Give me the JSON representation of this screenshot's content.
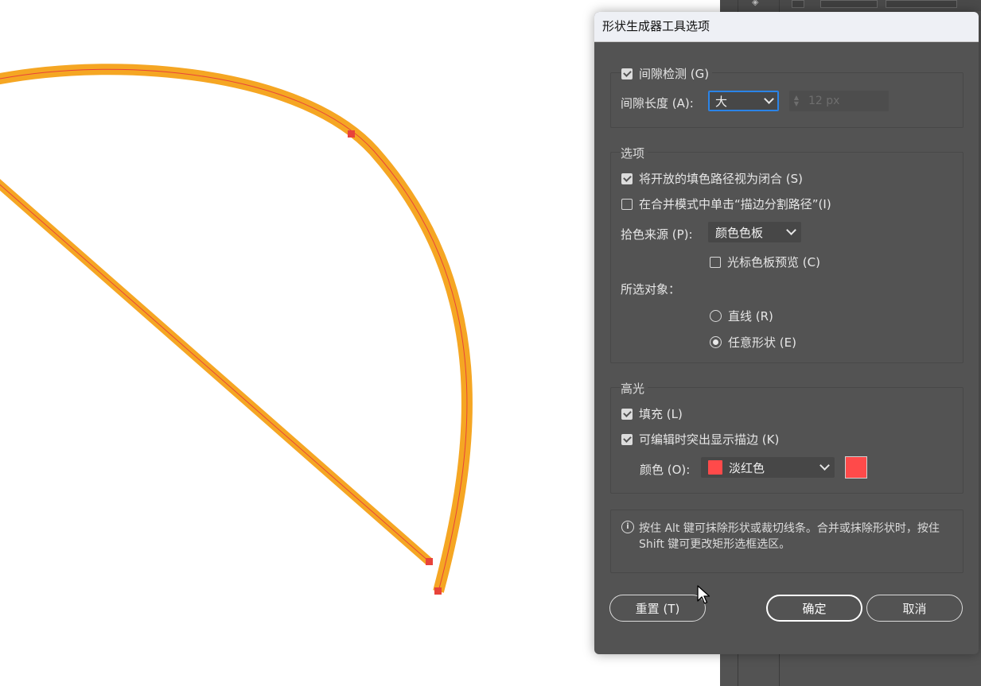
{
  "dialog": {
    "title": "形状生成器工具选项",
    "gap_detection": {
      "label": "间隙检测 (G)",
      "checked": true
    },
    "gap_length": {
      "label": "间隙长度 (A):",
      "value": "大",
      "px_value": "12 px"
    },
    "options": {
      "heading": "选项",
      "treat_open_paths": {
        "label": "将开放的填色路径视为闭合 (S)",
        "checked": true
      },
      "click_stroke_split": {
        "label": "在合并模式中单击“描边分割路径”(I)",
        "checked": false
      },
      "pick_color_from": {
        "label": "拾色来源 (P):",
        "value": "颜色色板"
      },
      "cursor_swatch_preview": {
        "label": "光标色板预览 (C)",
        "checked": false
      },
      "selection": {
        "label": "所选对象：",
        "straight_line": {
          "label": "直线 (R)",
          "selected": false
        },
        "freeform": {
          "label": "任意形状 (E)",
          "selected": true
        }
      }
    },
    "highlight": {
      "heading": "高光",
      "fill": {
        "label": "填充 (L)",
        "checked": true
      },
      "highlight_stroke": {
        "label": "可编辑时突出显示描边 (K)",
        "checked": true
      },
      "color": {
        "label": "颜色 (O):",
        "value": "淡红色",
        "hex": "#ff4a4a"
      }
    },
    "info": "按住 Alt 键可抹除形状或裁切线条。合并或抹除形状时，按住 Shift 键可更改矩形选框选区。",
    "buttons": {
      "reset": "重置 (T)",
      "ok": "确定",
      "cancel": "取消"
    }
  },
  "artwork": {
    "stroke_color": "#f5a623",
    "path_color": "#e8433a",
    "anchor_color": "#e8433a"
  },
  "icons": [
    "info-icon",
    "chevron-down-icon",
    "mouse-cursor-icon",
    "checkbox-icon",
    "radio-icon"
  ]
}
